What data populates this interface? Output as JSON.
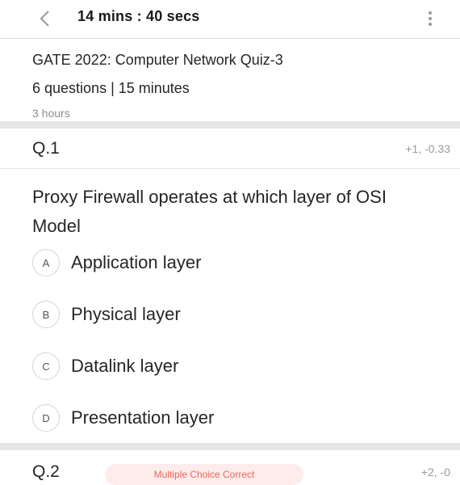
{
  "header": {
    "timer": "14 mins : 40 secs"
  },
  "quiz": {
    "title": "GATE 2022: Computer Network Quiz-3",
    "meta": "6 questions | 15 minutes",
    "time": "3 hours"
  },
  "questions": [
    {
      "number": "Q.1",
      "marks": "+1, -0.33",
      "text": "Proxy Firewall operates at which layer of OSI Model",
      "options": [
        {
          "letter": "A",
          "label": "Application layer"
        },
        {
          "letter": "B",
          "label": "Physical layer"
        },
        {
          "letter": "C",
          "label": "Datalink layer"
        },
        {
          "letter": "D",
          "label": "Presentation layer"
        }
      ]
    },
    {
      "number": "Q.2",
      "badge": "Multiple Choice Correct",
      "marks": "+2, -0"
    }
  ],
  "icons": {
    "back": "chevron-left-icon",
    "more": "more-vertical-icon"
  },
  "colors": {
    "badge_bg": "#fdeceb",
    "badge_text": "#e8675c"
  }
}
